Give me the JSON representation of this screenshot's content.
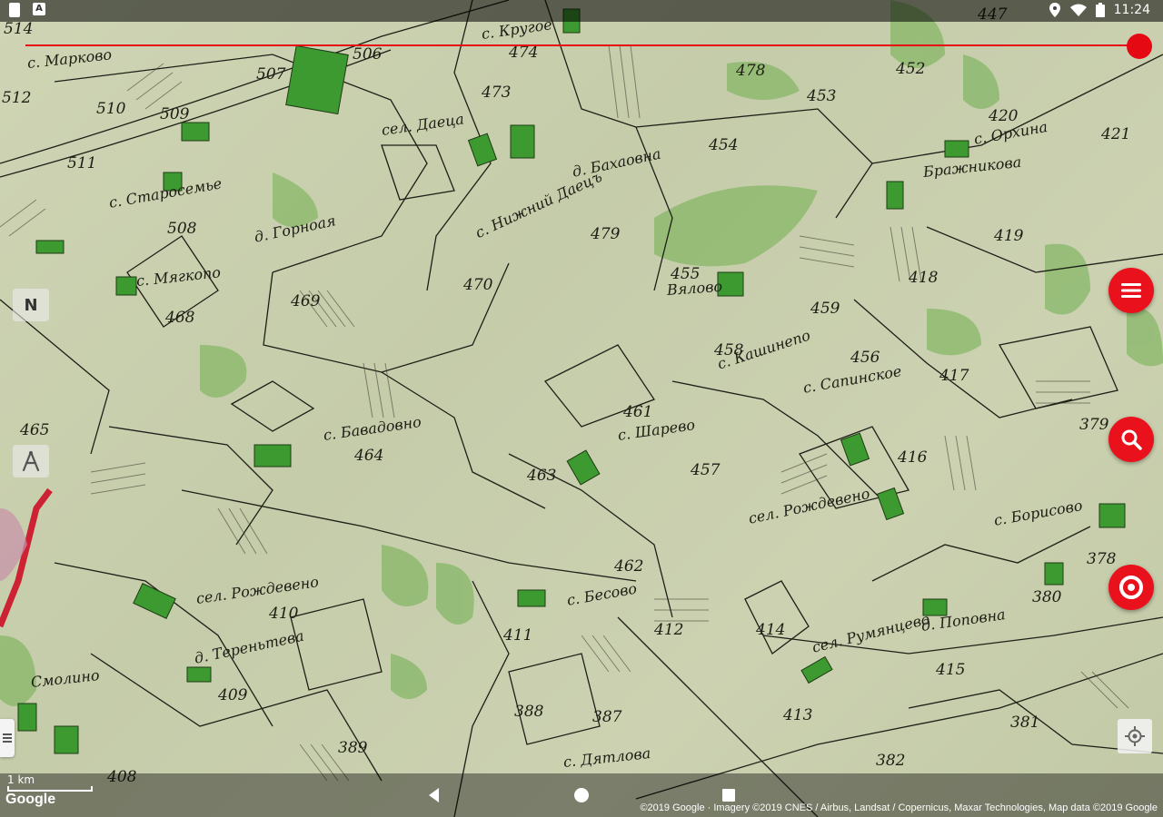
{
  "status_bar": {
    "time": "11:24",
    "icons": [
      "sd-card-icon",
      "letter-a-icon",
      "location-icon",
      "wifi-icon",
      "battery-icon"
    ]
  },
  "map": {
    "numbers": [
      "514",
      "507",
      "506",
      "474",
      "478",
      "452",
      "447",
      "512",
      "510",
      "509",
      "473",
      "453",
      "420",
      "421",
      "511",
      "479",
      "454",
      "419",
      "508",
      "455",
      "418",
      "470",
      "469",
      "468",
      "459",
      "458",
      "456",
      "417",
      "465",
      "461",
      "379",
      "464",
      "463",
      "416",
      "457",
      "462",
      "378",
      "380",
      "411",
      "412",
      "414",
      "410",
      "409",
      "415",
      "388",
      "387",
      "413",
      "389",
      "381",
      "382",
      "408"
    ],
    "villages": [
      "с. Кругое",
      "с. Марково",
      "с. Орхина",
      "сел. Даеца",
      "Бражникова",
      "д. Бахаовна",
      "с. Старосемье",
      "д. Горноая",
      "с. Нижний Даецъ",
      "с. Мягкопо",
      "Вялово",
      "с. Кашинепо",
      "с. Сапинское",
      "с. Бавадовно",
      "с. Шарево",
      "сел. Рождевено",
      "с. Борисово",
      "с. Бесово",
      "д. Поповна",
      "сел. Рождевено",
      "д. Тереньтева",
      "сел. Румянцево",
      "Смолино",
      "с. Дятлова"
    ],
    "colors": {
      "boundary": "#1e1e16",
      "forest": "#5aa33e",
      "building": "#3a8a2e",
      "road": "#cc2233"
    }
  },
  "overlays": {
    "north_label": "N",
    "scale_label": "1 km",
    "google_label": "Google",
    "attribution": "©2019 Google · Imagery ©2019 CNES / Airbus, Landsat / Copernicus, Maxar Technologies, Map data ©2019 Google"
  },
  "buttons": {
    "menu": "menu",
    "search": "search",
    "record": "target"
  }
}
